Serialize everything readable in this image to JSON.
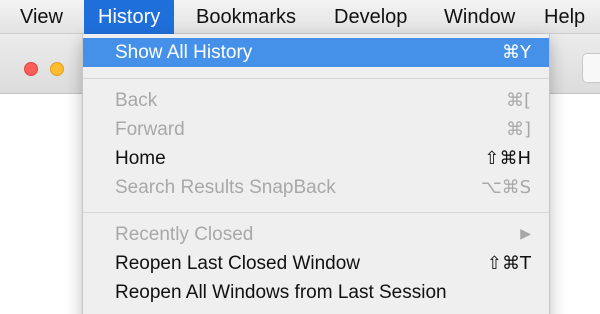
{
  "menubar": {
    "items": [
      {
        "label": "View"
      },
      {
        "label": "History"
      },
      {
        "label": "Bookmarks"
      },
      {
        "label": "Develop"
      },
      {
        "label": "Window"
      },
      {
        "label": "Help"
      }
    ],
    "active_item": "History"
  },
  "history_menu": {
    "items": [
      {
        "label": "Show All History",
        "shortcut": "⌘Y",
        "enabled": true,
        "highlighted": true
      },
      {
        "label": "Back",
        "shortcut": "⌘[",
        "enabled": false
      },
      {
        "label": "Forward",
        "shortcut": "⌘]",
        "enabled": false
      },
      {
        "label": "Home",
        "shortcut": "⇧⌘H",
        "enabled": true
      },
      {
        "label": "Search Results SnapBack",
        "shortcut": "⌥⌘S",
        "enabled": false
      },
      {
        "label": "Recently Closed",
        "submenu_icon": "▶",
        "enabled": false
      },
      {
        "label": "Reopen Last Closed Window",
        "shortcut": "⇧⌘T",
        "enabled": true
      },
      {
        "label": "Reopen All Windows from Last Session",
        "enabled": true
      }
    ]
  },
  "colors": {
    "accent": "#1f6fdb",
    "highlight": "#4591ea",
    "close_button": "#fc5f57",
    "minimize_button": "#fdbd2e"
  }
}
